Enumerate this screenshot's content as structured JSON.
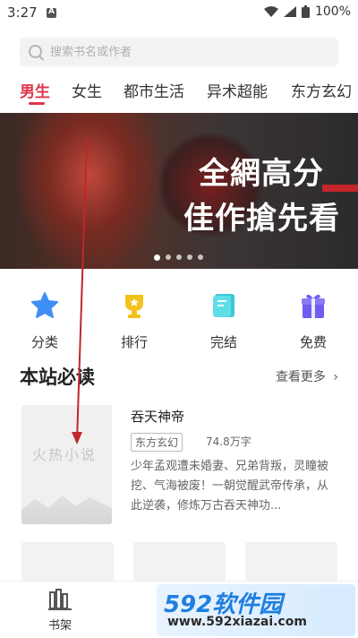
{
  "status_bar": {
    "time": "3:27",
    "battery": "100%"
  },
  "search": {
    "placeholder": "搜索书名或作者"
  },
  "tabs": [
    {
      "label": "男生"
    },
    {
      "label": "女生"
    },
    {
      "label": "都市生活"
    },
    {
      "label": "异术超能"
    },
    {
      "label": "东方玄幻"
    }
  ],
  "banner": {
    "line1": "全網高分",
    "line2": "佳作搶先看"
  },
  "categories": [
    {
      "label": "分类",
      "icon": "star-icon"
    },
    {
      "label": "排行",
      "icon": "trophy-icon"
    },
    {
      "label": "完结",
      "icon": "book-icon"
    },
    {
      "label": "免费",
      "icon": "gift-icon"
    }
  ],
  "section": {
    "title": "本站必读",
    "more": "查看更多"
  },
  "book": {
    "cover_text": "火热小说",
    "title": "吞天神帝",
    "tag": "东方玄幻",
    "words": "74.8万字",
    "desc": "少年孟观遭未婚妻、兄弟背叛，灵瞳被挖、气海被废！一朝觉醒武帝传承，从此逆袭，修炼万古吞天神功..."
  },
  "bottom_nav": {
    "shelf": "书架"
  },
  "watermark": {
    "logo": "592软件园",
    "url": "www.592xiazai.com"
  },
  "colors": {
    "accent": "#e0334a",
    "blue_icon": "#3f8ef5",
    "gold_icon": "#f3c11b",
    "teal_icon": "#3cc7d8",
    "purple_icon": "#6f5cf0"
  }
}
